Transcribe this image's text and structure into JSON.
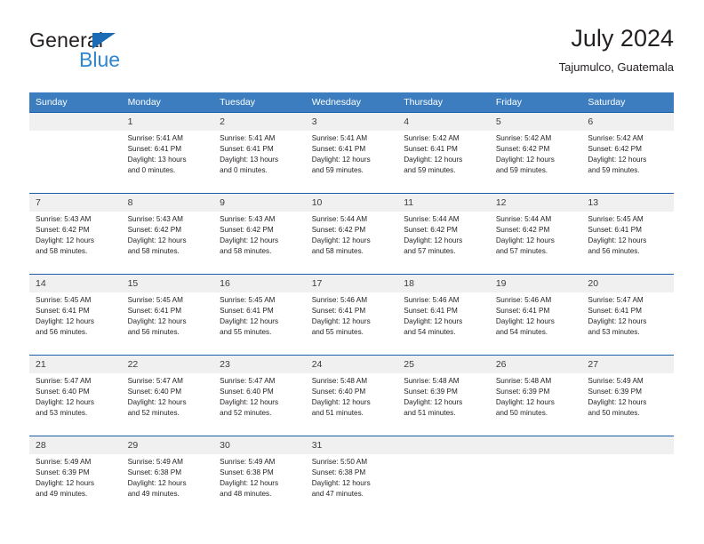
{
  "brand": {
    "word1": "General",
    "word2": "Blue",
    "triangle_color": "#1b6cb5",
    "blue_text_color": "#2e85d0"
  },
  "header": {
    "title": "July 2024",
    "subtitle": "Tajumulco, Guatemala"
  },
  "theme": {
    "header_bar": "#3b7dbe",
    "week_separator": "#1b5faa",
    "day_number_band": "#f0f0f0",
    "text": "#231f20"
  },
  "weekday_headers": [
    "Sunday",
    "Monday",
    "Tuesday",
    "Wednesday",
    "Thursday",
    "Friday",
    "Saturday"
  ],
  "labels": {
    "sunrise_prefix": "Sunrise:",
    "sunset_prefix": "Sunset:",
    "daylight_prefix": "Daylight:"
  },
  "weeks": [
    {
      "days": [
        {
          "day": "",
          "line1": "",
          "line2": "",
          "line3": "",
          "line4": ""
        },
        {
          "day": "1",
          "line1": "Sunrise: 5:41 AM",
          "line2": "Sunset: 6:41 PM",
          "line3": "Daylight: 13 hours",
          "line4": "and 0 minutes."
        },
        {
          "day": "2",
          "line1": "Sunrise: 5:41 AM",
          "line2": "Sunset: 6:41 PM",
          "line3": "Daylight: 13 hours",
          "line4": "and 0 minutes."
        },
        {
          "day": "3",
          "line1": "Sunrise: 5:41 AM",
          "line2": "Sunset: 6:41 PM",
          "line3": "Daylight: 12 hours",
          "line4": "and 59 minutes."
        },
        {
          "day": "4",
          "line1": "Sunrise: 5:42 AM",
          "line2": "Sunset: 6:41 PM",
          "line3": "Daylight: 12 hours",
          "line4": "and 59 minutes."
        },
        {
          "day": "5",
          "line1": "Sunrise: 5:42 AM",
          "line2": "Sunset: 6:42 PM",
          "line3": "Daylight: 12 hours",
          "line4": "and 59 minutes."
        },
        {
          "day": "6",
          "line1": "Sunrise: 5:42 AM",
          "line2": "Sunset: 6:42 PM",
          "line3": "Daylight: 12 hours",
          "line4": "and 59 minutes."
        }
      ]
    },
    {
      "days": [
        {
          "day": "7",
          "line1": "Sunrise: 5:43 AM",
          "line2": "Sunset: 6:42 PM",
          "line3": "Daylight: 12 hours",
          "line4": "and 58 minutes."
        },
        {
          "day": "8",
          "line1": "Sunrise: 5:43 AM",
          "line2": "Sunset: 6:42 PM",
          "line3": "Daylight: 12 hours",
          "line4": "and 58 minutes."
        },
        {
          "day": "9",
          "line1": "Sunrise: 5:43 AM",
          "line2": "Sunset: 6:42 PM",
          "line3": "Daylight: 12 hours",
          "line4": "and 58 minutes."
        },
        {
          "day": "10",
          "line1": "Sunrise: 5:44 AM",
          "line2": "Sunset: 6:42 PM",
          "line3": "Daylight: 12 hours",
          "line4": "and 58 minutes."
        },
        {
          "day": "11",
          "line1": "Sunrise: 5:44 AM",
          "line2": "Sunset: 6:42 PM",
          "line3": "Daylight: 12 hours",
          "line4": "and 57 minutes."
        },
        {
          "day": "12",
          "line1": "Sunrise: 5:44 AM",
          "line2": "Sunset: 6:42 PM",
          "line3": "Daylight: 12 hours",
          "line4": "and 57 minutes."
        },
        {
          "day": "13",
          "line1": "Sunrise: 5:45 AM",
          "line2": "Sunset: 6:41 PM",
          "line3": "Daylight: 12 hours",
          "line4": "and 56 minutes."
        }
      ]
    },
    {
      "days": [
        {
          "day": "14",
          "line1": "Sunrise: 5:45 AM",
          "line2": "Sunset: 6:41 PM",
          "line3": "Daylight: 12 hours",
          "line4": "and 56 minutes."
        },
        {
          "day": "15",
          "line1": "Sunrise: 5:45 AM",
          "line2": "Sunset: 6:41 PM",
          "line3": "Daylight: 12 hours",
          "line4": "and 56 minutes."
        },
        {
          "day": "16",
          "line1": "Sunrise: 5:45 AM",
          "line2": "Sunset: 6:41 PM",
          "line3": "Daylight: 12 hours",
          "line4": "and 55 minutes."
        },
        {
          "day": "17",
          "line1": "Sunrise: 5:46 AM",
          "line2": "Sunset: 6:41 PM",
          "line3": "Daylight: 12 hours",
          "line4": "and 55 minutes."
        },
        {
          "day": "18",
          "line1": "Sunrise: 5:46 AM",
          "line2": "Sunset: 6:41 PM",
          "line3": "Daylight: 12 hours",
          "line4": "and 54 minutes."
        },
        {
          "day": "19",
          "line1": "Sunrise: 5:46 AM",
          "line2": "Sunset: 6:41 PM",
          "line3": "Daylight: 12 hours",
          "line4": "and 54 minutes."
        },
        {
          "day": "20",
          "line1": "Sunrise: 5:47 AM",
          "line2": "Sunset: 6:41 PM",
          "line3": "Daylight: 12 hours",
          "line4": "and 53 minutes."
        }
      ]
    },
    {
      "days": [
        {
          "day": "21",
          "line1": "Sunrise: 5:47 AM",
          "line2": "Sunset: 6:40 PM",
          "line3": "Daylight: 12 hours",
          "line4": "and 53 minutes."
        },
        {
          "day": "22",
          "line1": "Sunrise: 5:47 AM",
          "line2": "Sunset: 6:40 PM",
          "line3": "Daylight: 12 hours",
          "line4": "and 52 minutes."
        },
        {
          "day": "23",
          "line1": "Sunrise: 5:47 AM",
          "line2": "Sunset: 6:40 PM",
          "line3": "Daylight: 12 hours",
          "line4": "and 52 minutes."
        },
        {
          "day": "24",
          "line1": "Sunrise: 5:48 AM",
          "line2": "Sunset: 6:40 PM",
          "line3": "Daylight: 12 hours",
          "line4": "and 51 minutes."
        },
        {
          "day": "25",
          "line1": "Sunrise: 5:48 AM",
          "line2": "Sunset: 6:39 PM",
          "line3": "Daylight: 12 hours",
          "line4": "and 51 minutes."
        },
        {
          "day": "26",
          "line1": "Sunrise: 5:48 AM",
          "line2": "Sunset: 6:39 PM",
          "line3": "Daylight: 12 hours",
          "line4": "and 50 minutes."
        },
        {
          "day": "27",
          "line1": "Sunrise: 5:49 AM",
          "line2": "Sunset: 6:39 PM",
          "line3": "Daylight: 12 hours",
          "line4": "and 50 minutes."
        }
      ]
    },
    {
      "days": [
        {
          "day": "28",
          "line1": "Sunrise: 5:49 AM",
          "line2": "Sunset: 6:39 PM",
          "line3": "Daylight: 12 hours",
          "line4": "and 49 minutes."
        },
        {
          "day": "29",
          "line1": "Sunrise: 5:49 AM",
          "line2": "Sunset: 6:38 PM",
          "line3": "Daylight: 12 hours",
          "line4": "and 49 minutes."
        },
        {
          "day": "30",
          "line1": "Sunrise: 5:49 AM",
          "line2": "Sunset: 6:38 PM",
          "line3": "Daylight: 12 hours",
          "line4": "and 48 minutes."
        },
        {
          "day": "31",
          "line1": "Sunrise: 5:50 AM",
          "line2": "Sunset: 6:38 PM",
          "line3": "Daylight: 12 hours",
          "line4": "and 47 minutes."
        },
        {
          "day": "",
          "line1": "",
          "line2": "",
          "line3": "",
          "line4": ""
        },
        {
          "day": "",
          "line1": "",
          "line2": "",
          "line3": "",
          "line4": ""
        },
        {
          "day": "",
          "line1": "",
          "line2": "",
          "line3": "",
          "line4": ""
        }
      ]
    }
  ]
}
